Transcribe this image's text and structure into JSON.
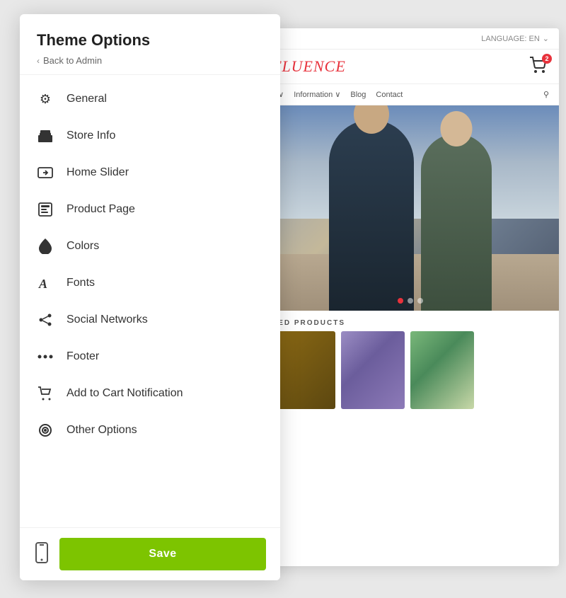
{
  "panel": {
    "title": "Theme Options",
    "back_label": "Back to Admin",
    "nav_items": [
      {
        "id": "general",
        "label": "General",
        "icon": "gear"
      },
      {
        "id": "store-info",
        "label": "Store Info",
        "icon": "store"
      },
      {
        "id": "home-slider",
        "label": "Home Slider",
        "icon": "slider"
      },
      {
        "id": "product-page",
        "label": "Product Page",
        "icon": "product"
      },
      {
        "id": "colors",
        "label": "Colors",
        "icon": "colors"
      },
      {
        "id": "fonts",
        "label": "Fonts",
        "icon": "fonts"
      },
      {
        "id": "social-networks",
        "label": "Social Networks",
        "icon": "share"
      },
      {
        "id": "footer",
        "label": "Footer",
        "icon": "footer"
      },
      {
        "id": "add-to-cart",
        "label": "Add to Cart Notification",
        "icon": "cart"
      },
      {
        "id": "other-options",
        "label": "Other Options",
        "icon": "options"
      }
    ],
    "save_label": "Save"
  },
  "preview": {
    "language_label": "LANGUAGE: EN",
    "logo_text": "FLUENCE",
    "cart_count": "2",
    "nav_items": [
      "n ∨",
      "Information ∨",
      "Blog",
      "Contact"
    ],
    "section_title": "RED PRODUCTS",
    "hero_dots": 3,
    "hero_active_dot": 0
  },
  "colors": {
    "accent": "#7dc400",
    "logo_color": "#e8323c",
    "cart_badge": "#e8323c"
  }
}
